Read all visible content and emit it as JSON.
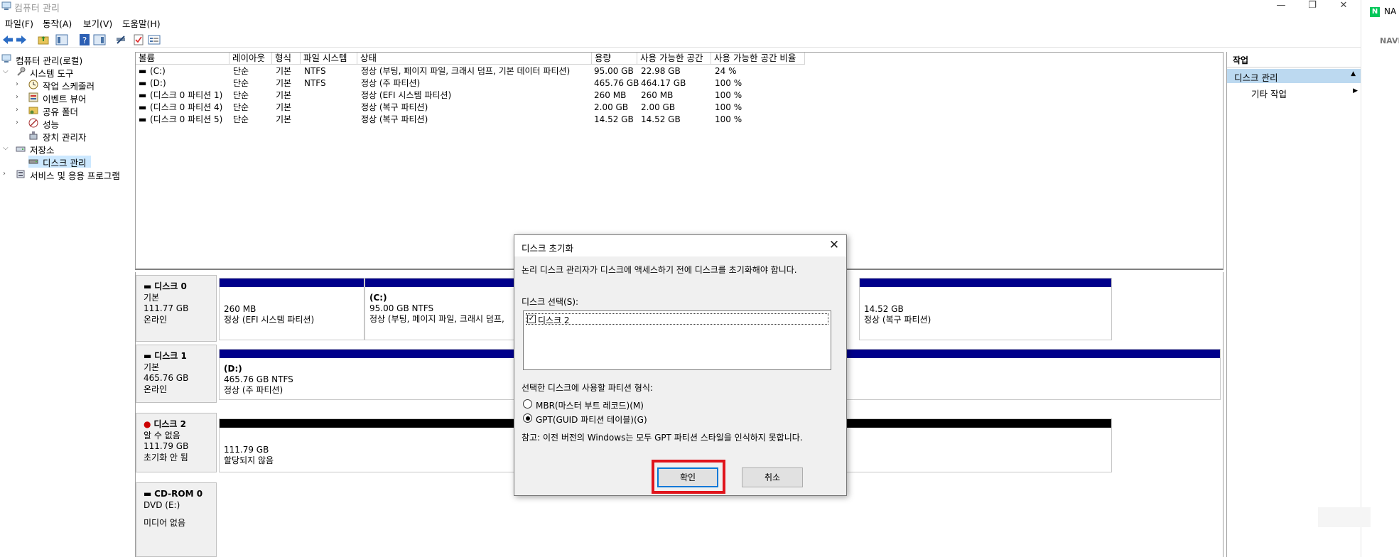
{
  "window": {
    "title": "컴퓨터 관리",
    "minimize": "—",
    "maximize": "❐",
    "close": "✕"
  },
  "menu": [
    "파일(F)",
    "동작(A)",
    "보기(V)",
    "도움말(H)"
  ],
  "tree": {
    "root": "컴퓨터 관리(로컬)",
    "system_tools": "시스템 도구",
    "task_scheduler": "작업 스케줄러",
    "event_viewer": "이벤트 뷰어",
    "shared_folders": "공유 폴더",
    "performance": "성능",
    "device_manager": "장치 관리자",
    "storage": "저장소",
    "disk_management": "디스크 관리",
    "services_apps": "서비스 및 응용 프로그램"
  },
  "volumes": {
    "headers": [
      "볼륨",
      "레이아웃",
      "형식",
      "파일 시스템",
      "상태",
      "용량",
      "사용 가능한 공간",
      "사용 가능한 공간 비율"
    ],
    "rows": [
      [
        "(C:)",
        "단순",
        "기본",
        "NTFS",
        "정상 (부팅, 페이지 파일, 크래시 덤프, 기본 데이터 파티션)",
        "95.00 GB",
        "22.98 GB",
        "24 %"
      ],
      [
        "(D:)",
        "단순",
        "기본",
        "NTFS",
        "정상 (주 파티션)",
        "465.76 GB",
        "464.17 GB",
        "100 %"
      ],
      [
        "(디스크 0 파티션 1)",
        "단순",
        "기본",
        "",
        "정상 (EFI 시스템 파티션)",
        "260 MB",
        "260 MB",
        "100 %"
      ],
      [
        "(디스크 0 파티션 4)",
        "단순",
        "기본",
        "",
        "정상 (복구 파티션)",
        "2.00 GB",
        "2.00 GB",
        "100 %"
      ],
      [
        "(디스크 0 파티션 5)",
        "단순",
        "기본",
        "",
        "정상 (복구 파티션)",
        "14.52 GB",
        "14.52 GB",
        "100 %"
      ]
    ]
  },
  "disks": {
    "disk0": {
      "name": "디스크 0",
      "type": "기본",
      "size": "111.77 GB",
      "status": "온라인",
      "p1": {
        "size": "260 MB",
        "status": "정상 (EFI 시스템 파티션)"
      },
      "p2": {
        "label": "(C:)",
        "size": "95.00 GB NTFS",
        "status": "정상 (부팅, 페이지 파일, 크래시 덤프,"
      },
      "p3": {
        "size": "14.52 GB",
        "status": "정상 (복구 파티션)"
      }
    },
    "disk1": {
      "name": "디스크 1",
      "type": "기본",
      "size": "465.76 GB",
      "status": "온라인",
      "p1": {
        "label": "(D:)",
        "size": "465.76 GB NTFS",
        "status": "정상 (주 파티션)"
      }
    },
    "disk2": {
      "name": "디스크 2",
      "type": "알 수 없음",
      "size": "111.79 GB",
      "status": "초기화 안 됨",
      "p1": {
        "size": "111.79 GB",
        "status": "할당되지 않음"
      }
    },
    "cdrom0": {
      "name": "CD-ROM 0",
      "type": "DVD (E:)",
      "status": "미디어 없음"
    }
  },
  "actions": {
    "header": "작업",
    "section": "디스크 관리",
    "item": "기타 작업"
  },
  "edge": {
    "badge": "N",
    "text1": "NA",
    "text2": "NAVE"
  },
  "dialog": {
    "title": "디스크 초기화",
    "message": "논리 디스크 관리자가 디스크에 액세스하기 전에 디스크를 초기화해야 합니다.",
    "select_label": "디스크 선택(S):",
    "disk_item": "디스크 2",
    "partition_label": "선택한 디스크에 사용할 파티션 형식:",
    "mbr": "MBR(마스터 부트 레코드)(M)",
    "gpt": "GPT(GUID 파티션 테이블)(G)",
    "note": "참고: 이전 버전의 Windows는 모두 GPT 파티션 스타일을 인식하지 못합니다.",
    "ok": "확인",
    "cancel": "취소"
  },
  "colors": {
    "primary_bar": "#00008b",
    "unallocated_bar": "#000000",
    "highlight": "#e0141c",
    "selection": "#cce8ff"
  }
}
